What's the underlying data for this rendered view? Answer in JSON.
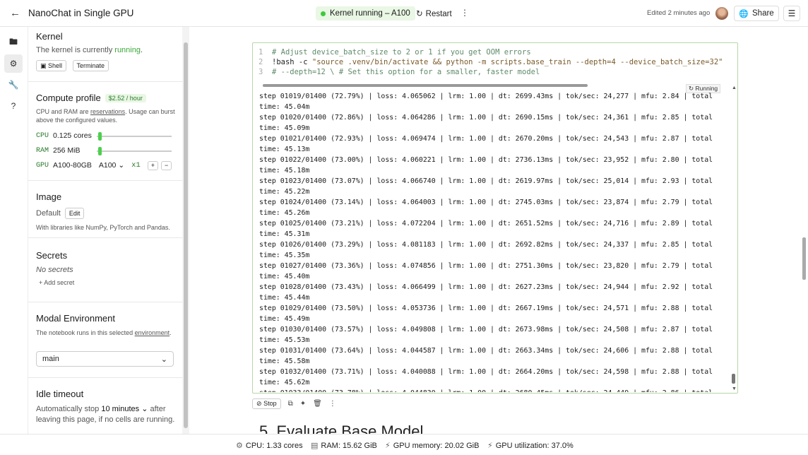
{
  "header": {
    "title": "NanoChat in Single GPU",
    "kernel_status": "Kernel running – A100",
    "restart_label": "Restart",
    "edited": "Edited 2 minutes ago",
    "share_label": "Share"
  },
  "sidebar": {
    "kernel": {
      "heading": "Kernel",
      "text_prefix": "The kernel is currently",
      "state": "running",
      "text_suffix": ".",
      "shell_label": "Shell",
      "terminate_label": "Terminate"
    },
    "compute": {
      "heading": "Compute profile",
      "price": "$2.52 / hour",
      "desc_1": "CPU and RAM are",
      "desc_link": "reservations",
      "desc_2": ". Usage can burst above the configured values.",
      "cpu_label": "CPU",
      "cpu_value": "0.125 cores",
      "cpu_level": 0.02,
      "ram_label": "RAM",
      "ram_value": "256 MiB",
      "ram_level": 0.02,
      "gpu_label": "GPU",
      "gpu_value": "A100-80GB",
      "gpu_select": "A100",
      "gpu_count": "x1",
      "plus": "+",
      "minus": "−"
    },
    "image": {
      "heading": "Image",
      "value": "Default",
      "edit_label": "Edit",
      "desc": "With libraries like NumPy, PyTorch and Pandas."
    },
    "secrets": {
      "heading": "Secrets",
      "empty": "No secrets",
      "add_label": "Add secret"
    },
    "environment": {
      "heading": "Modal Environment",
      "desc_1": "The notebook runs in this selected",
      "desc_link": "environment",
      "desc_2": ".",
      "selected": "main"
    },
    "idle": {
      "heading": "Idle timeout",
      "text_1": "Automatically stop",
      "value": "10 minutes",
      "text_2": "after leaving this page, if no cells are running."
    }
  },
  "cell": {
    "code": [
      {
        "n": "1",
        "text": "# Adjust device_batch_size to 2 or 1 if you get OOM errors"
      },
      {
        "n": "2",
        "cmd": "!bash -c ",
        "arg": "\"source .venv/bin/activate && python -m scripts.base_train --depth=4 --device_batch_size=32\""
      },
      {
        "n": "3",
        "text": "# --depth=12 \\ # Set this option for a smaller, faster model"
      }
    ],
    "running_label": "Running",
    "output": [
      "step 01019/01400 (72.79%) | loss: 4.065062 | lrm: 1.00 | dt: 2699.43ms | tok/sec: 24,277 | mfu: 2.84 | total",
      "time: 45.04m",
      "step 01020/01400 (72.86%) | loss: 4.064286 | lrm: 1.00 | dt: 2690.15ms | tok/sec: 24,361 | mfu: 2.85 | total",
      "time: 45.09m",
      "step 01021/01400 (72.93%) | loss: 4.069474 | lrm: 1.00 | dt: 2670.20ms | tok/sec: 24,543 | mfu: 2.87 | total",
      "time: 45.13m",
      "step 01022/01400 (73.00%) | loss: 4.060221 | lrm: 1.00 | dt: 2736.13ms | tok/sec: 23,952 | mfu: 2.80 | total",
      "time: 45.18m",
      "step 01023/01400 (73.07%) | loss: 4.066740 | lrm: 1.00 | dt: 2619.97ms | tok/sec: 25,014 | mfu: 2.93 | total",
      "time: 45.22m",
      "step 01024/01400 (73.14%) | loss: 4.064003 | lrm: 1.00 | dt: 2745.03ms | tok/sec: 23,874 | mfu: 2.79 | total",
      "time: 45.26m",
      "step 01025/01400 (73.21%) | loss: 4.072204 | lrm: 1.00 | dt: 2651.52ms | tok/sec: 24,716 | mfu: 2.89 | total",
      "time: 45.31m",
      "step 01026/01400 (73.29%) | loss: 4.081183 | lrm: 1.00 | dt: 2692.82ms | tok/sec: 24,337 | mfu: 2.85 | total",
      "time: 45.35m",
      "step 01027/01400 (73.36%) | loss: 4.074856 | lrm: 1.00 | dt: 2751.30ms | tok/sec: 23,820 | mfu: 2.79 | total",
      "time: 45.40m",
      "step 01028/01400 (73.43%) | loss: 4.066499 | lrm: 1.00 | dt: 2627.23ms | tok/sec: 24,944 | mfu: 2.92 | total",
      "time: 45.44m",
      "step 01029/01400 (73.50%) | loss: 4.053736 | lrm: 1.00 | dt: 2667.19ms | tok/sec: 24,571 | mfu: 2.88 | total",
      "time: 45.49m",
      "step 01030/01400 (73.57%) | loss: 4.049808 | lrm: 1.00 | dt: 2673.98ms | tok/sec: 24,508 | mfu: 2.87 | total",
      "time: 45.53m",
      "step 01031/01400 (73.64%) | loss: 4.044587 | lrm: 1.00 | dt: 2663.34ms | tok/sec: 24,606 | mfu: 2.88 | total",
      "time: 45.58m",
      "step 01032/01400 (73.71%) | loss: 4.040088 | lrm: 1.00 | dt: 2664.20ms | tok/sec: 24,598 | mfu: 2.88 | total",
      "time: 45.62m",
      "step 01033/01400 (73.78%) | loss: 4.044830 | lrm: 1.00 | dt: 2680.45ms | tok/sec: 24,449 | mfu: 2.86 | total"
    ],
    "stop_label": "Stop"
  },
  "next_heading": "5. Evaluate Base Model",
  "status": {
    "cpu_label": "CPU:",
    "cpu_value": "1.33 cores",
    "ram_label": "RAM:",
    "ram_value": "15.62 GiB",
    "gpu_mem_label": "GPU memory:",
    "gpu_mem_value": "20.02 GiB",
    "gpu_util_label": "GPU utilization:",
    "gpu_util_value": "37.0%"
  },
  "colors": {
    "accent_green": "#3ec93e",
    "running_text": "#3aa83a",
    "pill_bg": "#e9f7e4"
  },
  "icons": [
    "back-arrow-icon",
    "restart-icon",
    "kebab-icon",
    "globe-icon",
    "hamburger-icon",
    "folder-icon",
    "cpu-chip-icon",
    "wrench-icon",
    "help-icon",
    "terminal-icon",
    "plus-icon",
    "chevron-down-icon",
    "stop-icon",
    "copy-icon",
    "sparkle-icon",
    "trash-icon",
    "memory-icon",
    "gpu-icon"
  ]
}
